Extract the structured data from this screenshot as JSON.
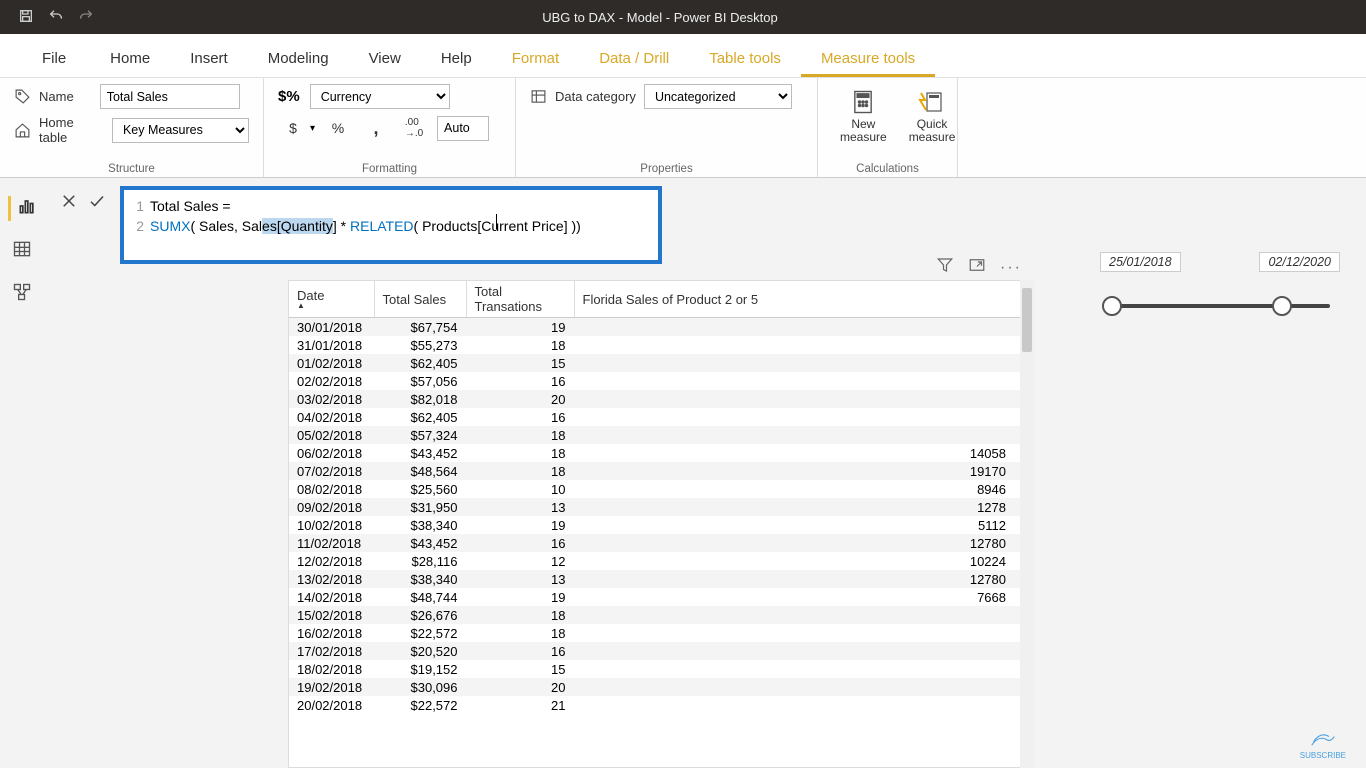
{
  "window": {
    "title": "UBG to DAX - Model - Power BI Desktop"
  },
  "tabs": {
    "file": "File",
    "items": [
      "Home",
      "Insert",
      "Modeling",
      "View",
      "Help",
      "Format",
      "Data / Drill",
      "Table tools",
      "Measure tools"
    ],
    "contextual_from_index": 5,
    "active_index": 8
  },
  "structure": {
    "name_label": "Name",
    "name_value": "Total Sales",
    "home_table_label": "Home table",
    "home_table_value": "Key Measures",
    "group_label": "Structure"
  },
  "formatting": {
    "format_value": "Currency",
    "decimal_value": "Auto",
    "btns": {
      "dollar": "$",
      "percent": "%",
      "comma": ",",
      "dec": ".00"
    },
    "group_label": "Formatting"
  },
  "properties": {
    "label": "Data category",
    "value": "Uncategorized",
    "group_label": "Properties"
  },
  "calculations": {
    "new_measure": "New\nmeasure",
    "quick_measure": "Quick\nmeasure",
    "group_label": "Calculations"
  },
  "formula": {
    "line1": "Total Sales =",
    "line2_pre": "SUMX",
    "line2_mid1": "( Sales, Sal",
    "line2_sel": "es[Quantity",
    "line2_mid2": "] * ",
    "line2_rel": "RELATED",
    "line2_post": "( Products[Current Price] ))",
    "gutter": [
      "1",
      "2"
    ]
  },
  "slicer": {
    "from": "25/01/2018",
    "to": "02/12/2020"
  },
  "table": {
    "headers": [
      "Date",
      "Total Sales",
      "Total Transations",
      "Florida Sales of Product 2 or 5"
    ],
    "rows": [
      {
        "d": "30/01/2018",
        "s": "$67,754",
        "t": "19",
        "f": ""
      },
      {
        "d": "31/01/2018",
        "s": "$55,273",
        "t": "18",
        "f": ""
      },
      {
        "d": "01/02/2018",
        "s": "$62,405",
        "t": "15",
        "f": ""
      },
      {
        "d": "02/02/2018",
        "s": "$57,056",
        "t": "16",
        "f": ""
      },
      {
        "d": "03/02/2018",
        "s": "$82,018",
        "t": "20",
        "f": ""
      },
      {
        "d": "04/02/2018",
        "s": "$62,405",
        "t": "16",
        "f": ""
      },
      {
        "d": "05/02/2018",
        "s": "$57,324",
        "t": "18",
        "f": ""
      },
      {
        "d": "06/02/2018",
        "s": "$43,452",
        "t": "18",
        "f": "14058"
      },
      {
        "d": "07/02/2018",
        "s": "$48,564",
        "t": "18",
        "f": "19170"
      },
      {
        "d": "08/02/2018",
        "s": "$25,560",
        "t": "10",
        "f": "8946"
      },
      {
        "d": "09/02/2018",
        "s": "$31,950",
        "t": "13",
        "f": "1278"
      },
      {
        "d": "10/02/2018",
        "s": "$38,340",
        "t": "19",
        "f": "5112"
      },
      {
        "d": "11/02/2018",
        "s": "$43,452",
        "t": "16",
        "f": "12780"
      },
      {
        "d": "12/02/2018",
        "s": "$28,116",
        "t": "12",
        "f": "10224"
      },
      {
        "d": "13/02/2018",
        "s": "$38,340",
        "t": "13",
        "f": "12780"
      },
      {
        "d": "14/02/2018",
        "s": "$48,744",
        "t": "19",
        "f": "7668"
      },
      {
        "d": "15/02/2018",
        "s": "$26,676",
        "t": "18",
        "f": ""
      },
      {
        "d": "16/02/2018",
        "s": "$22,572",
        "t": "18",
        "f": ""
      },
      {
        "d": "17/02/2018",
        "s": "$20,520",
        "t": "16",
        "f": ""
      },
      {
        "d": "18/02/2018",
        "s": "$19,152",
        "t": "15",
        "f": ""
      },
      {
        "d": "19/02/2018",
        "s": "$30,096",
        "t": "20",
        "f": ""
      },
      {
        "d": "20/02/2018",
        "s": "$22,572",
        "t": "21",
        "f": ""
      }
    ]
  },
  "subscribe": "SUBSCRIBE"
}
